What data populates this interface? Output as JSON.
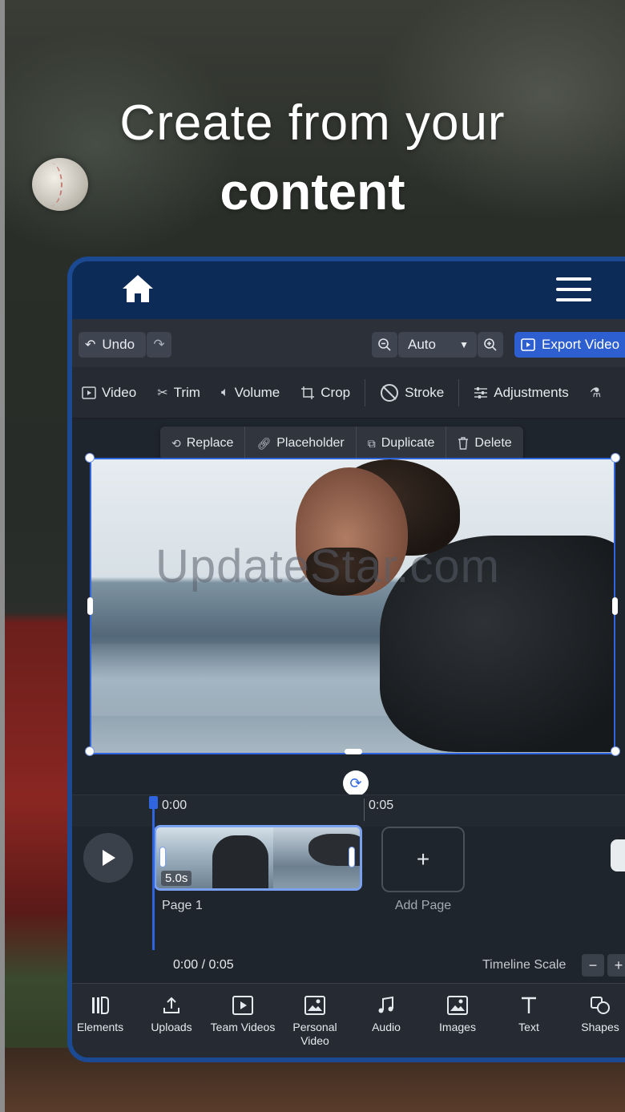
{
  "headline": {
    "line1": "Create from your",
    "line2": "content"
  },
  "toolbar": {
    "undo_label": "Undo",
    "zoom_value": "Auto",
    "export_label": "Export Video"
  },
  "edit_tools": [
    {
      "label": "Video",
      "icon": "video-icon"
    },
    {
      "label": "Trim",
      "icon": "trim-icon"
    },
    {
      "label": "Volume",
      "icon": "volume-icon"
    },
    {
      "label": "Crop",
      "icon": "crop-icon"
    },
    {
      "label": "Stroke",
      "icon": "stroke-icon"
    },
    {
      "label": "Adjustments",
      "icon": "adjustments-icon"
    }
  ],
  "context_menu": [
    {
      "label": "Replace",
      "icon": "replace-icon"
    },
    {
      "label": "Placeholder",
      "icon": "link-icon"
    },
    {
      "label": "Duplicate",
      "icon": "duplicate-icon"
    },
    {
      "label": "Delete",
      "icon": "trash-icon"
    }
  ],
  "canvas": {
    "watermark": "UpdateStar.com"
  },
  "timeline": {
    "tick_start": "0:00",
    "tick_end": "0:05",
    "clip_duration": "5.0s",
    "page_label": "Page 1",
    "add_page_label": "Add Page",
    "add_page_symbol": "+",
    "time_readout": "0:00 / 0:05",
    "scale_label": "Timeline Scale"
  },
  "bottom_nav": [
    {
      "label": "Elements",
      "icon": "elements-icon"
    },
    {
      "label": "Uploads",
      "icon": "upload-icon"
    },
    {
      "label": "Team Videos",
      "icon": "team-videos-icon"
    },
    {
      "label": "Personal Video",
      "icon": "personal-video-icon"
    },
    {
      "label": "Audio",
      "icon": "music-note-icon"
    },
    {
      "label": "Images",
      "icon": "image-icon"
    },
    {
      "label": "Text",
      "icon": "text-icon"
    },
    {
      "label": "Shapes",
      "icon": "shapes-icon"
    }
  ],
  "colors": {
    "accent": "#2f66e0",
    "topbar": "#0d2b57",
    "frame_border": "#1b4a93",
    "panel": "#1f252d"
  }
}
